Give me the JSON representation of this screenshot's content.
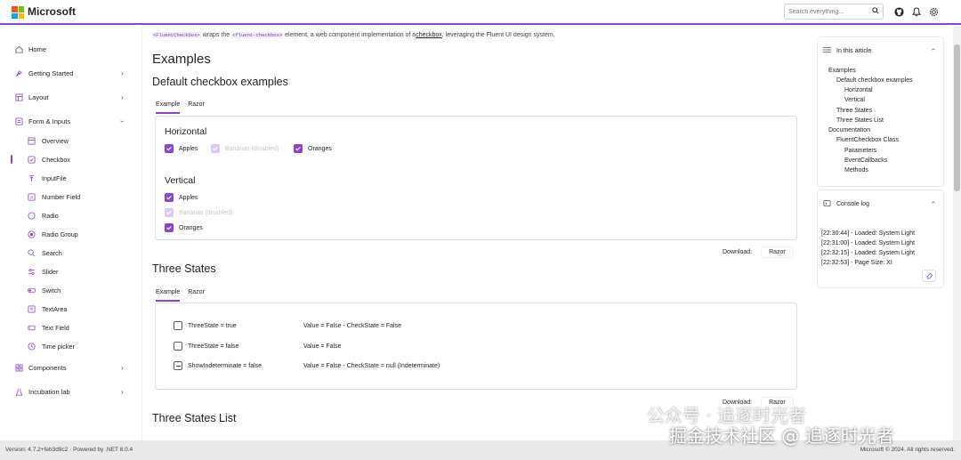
{
  "header": {
    "brand": "Microsoft",
    "search_placeholder": "Search everything...",
    "accent": "#8b46c7",
    "icons": [
      "search-icon",
      "github-icon",
      "bell-icon",
      "gear-icon"
    ]
  },
  "sidebar": {
    "items": [
      {
        "label": "Home",
        "icon": "home-icon"
      },
      {
        "label": "Getting Started",
        "icon": "rocket-icon"
      },
      {
        "label": "Layout",
        "icon": "layout-icon"
      },
      {
        "label": "Form & Inputs",
        "icon": "form-icon"
      },
      {
        "label": "Components",
        "icon": "components-icon"
      },
      {
        "label": "Incubation lab",
        "icon": "beaker-icon"
      }
    ],
    "sub_items": [
      {
        "label": "Overview",
        "icon": "overview-icon"
      },
      {
        "label": "Checkbox",
        "icon": "checkbox-icon",
        "active": true
      },
      {
        "label": "InputFile",
        "icon": "upload-icon"
      },
      {
        "label": "Number Field",
        "icon": "number-icon"
      },
      {
        "label": "Radio",
        "icon": "radio-icon"
      },
      {
        "label": "Radio Group",
        "icon": "radio-group-icon"
      },
      {
        "label": "Search",
        "icon": "search-icon"
      },
      {
        "label": "Slider",
        "icon": "slider-icon"
      },
      {
        "label": "Switch",
        "icon": "switch-icon"
      },
      {
        "label": "TextArea",
        "icon": "textarea-icon"
      },
      {
        "label": "Text Field",
        "icon": "textfield-icon"
      },
      {
        "label": "Time picker",
        "icon": "clock-icon"
      }
    ]
  },
  "main": {
    "intro": {
      "code1": "<FluentCheckbox>",
      "t1": " wraps the ",
      "code2": "<fluent-checkbox>",
      "t2": " element, a web component implementation of a",
      "link": "checkbox",
      "t3": ", leveraging the Fluent UI design system."
    },
    "title": "Examples",
    "section1": {
      "heading": "Default checkbox examples",
      "tabs": [
        "Example",
        "Razor"
      ],
      "horizontal_title": "Horizontal",
      "vertical_title": "Vertical",
      "apples": "Apples",
      "bananas": "Bananas (disabled)",
      "oranges": "Oranges",
      "download_label": "Download:",
      "download_btn": "Razor"
    },
    "section2": {
      "heading": "Three States",
      "tabs": [
        "Example",
        "Razor"
      ],
      "rows": [
        {
          "label": "ThreeState = true",
          "value": "Value = False - CheckState = False"
        },
        {
          "label": "ThreeState = false",
          "value": "Value = False"
        },
        {
          "label": "ShowIndeterminate = false",
          "value": "Value = False - CheckState = null (Indeterminate)"
        }
      ],
      "download_label": "Download:",
      "download_btn": "Razor"
    },
    "section3": {
      "heading": "Three States List"
    }
  },
  "toc": {
    "title": "In this article",
    "items": [
      {
        "label": "Examples",
        "level": 0
      },
      {
        "label": "Default checkbox examples",
        "level": 1
      },
      {
        "label": "Horizontal",
        "level": 2
      },
      {
        "label": "Vertical",
        "level": 2
      },
      {
        "label": "Three States",
        "level": 1
      },
      {
        "label": "Three States List",
        "level": 1
      },
      {
        "label": "Documentation",
        "level": 0
      },
      {
        "label": "FluentCheckbox Class",
        "level": 1
      },
      {
        "label": "Parameters",
        "level": 2
      },
      {
        "label": "EventCallbacks",
        "level": 2
      },
      {
        "label": "Methods",
        "level": 2
      }
    ]
  },
  "console": {
    "title": "Console log",
    "lines": [
      "[22:30:44] - Loaded: System Light",
      "[22:31:00] - Loaded: System Light",
      "[22:32:15] - Loaded: System Light",
      "[22:32:53] - Page Size: XI"
    ]
  },
  "footer": {
    "left": "Version: 4.7.2+feb3d9c2  ·  Powered by .NET 8.0.4",
    "right": "Microsoft © 2024. All rights reserved."
  },
  "watermark": {
    "line1": "公众号 · 追逐时光者",
    "line2": "掘金技术社区 @ 追逐时光者"
  }
}
